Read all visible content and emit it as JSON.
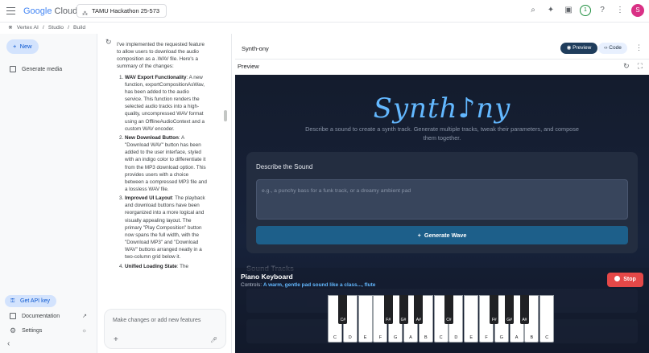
{
  "topbar": {
    "logo_google": "Google",
    "logo_cloud": "Cloud",
    "project": "TAMU Hackathon 25-573",
    "notifications": "1",
    "avatar_letter": "S"
  },
  "breadcrumb": [
    "Vertex AI",
    "Studio",
    "Build"
  ],
  "sidebar": {
    "new_label": "New",
    "items": [
      {
        "label": "Generate media"
      }
    ],
    "api_key": "Get API key",
    "documentation": "Documentation",
    "settings": "Settings"
  },
  "chat": {
    "intro": "I've implemented the requested feature to allow users to download the audio composition as a .WAV file. Here's a summary of the changes:",
    "items": [
      {
        "title": "WAV Export Functionality",
        "text": ": A new function, exportCompositionAsWav, has been added to the audio service. This function renders the selected audio tracks into a high-quality, uncompressed WAV format using an OfflineAudioContext and a custom WAV encoder."
      },
      {
        "title": "New Download Button",
        "text": ": A \"Download WAV\" button has been added to the user interface, styled with an indigo color to differentiate it from the MP3 download option. This provides users with a choice between a compressed MP3 file and a lossless WAV file."
      },
      {
        "title": "Improved UI Layout",
        "text": ": The playback and download buttons have been reorganized into a more logical and visually appealing layout. The primary \"Play Composition\" button now spans the full width, with the \"Download MP3\" and \"Download WAV\" buttons arranged neatly in a two-column grid below it."
      },
      {
        "title": "Unified Loading State",
        "text": ": The"
      }
    ],
    "input_placeholder": "Make changes or add new features"
  },
  "app": {
    "title": "Synth-ony",
    "preview_btn": "Preview",
    "code_btn": "Code",
    "preview_label": "Preview",
    "brand": "Synth♪ny",
    "description": "Describe a sound to create a synth track. Generate multiple tracks, tweak their parameters, and compose them together.",
    "describe_title": "Describe the Sound",
    "describe_placeholder": "e.g., a punchy bass for a funk track, or a dreamy ambient pad",
    "generate_btn": "Generate Wave",
    "tracks_title": "Sound Tracks",
    "piano": {
      "title": "Piano Keyboard",
      "controls_label": "Controls:",
      "controls_value": "A warm, gentle pad sound like a class..., flute",
      "stop_btn": "Stop",
      "white_keys": [
        "C",
        "D",
        "E",
        "F",
        "G",
        "A",
        "B",
        "C",
        "D",
        "E",
        "F",
        "G",
        "A",
        "B",
        "C"
      ],
      "black_keys": [
        "C#",
        "F#",
        "G#",
        "A#",
        "C#",
        "F#",
        "G#",
        "A#"
      ]
    }
  }
}
